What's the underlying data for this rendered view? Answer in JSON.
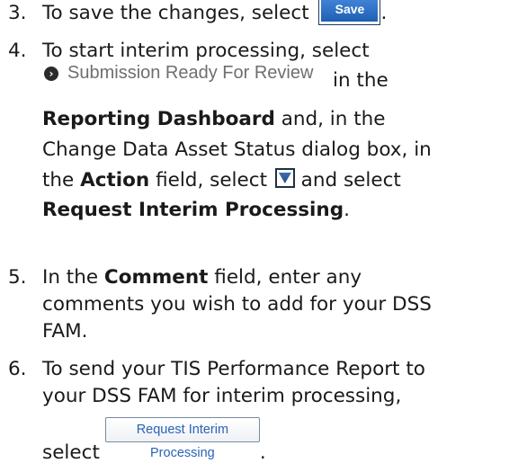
{
  "steps": [
    {
      "number": "3.",
      "text_before": "To save the changes, select",
      "button_label": "Save",
      "text_after": "."
    },
    {
      "number": "4.",
      "line1": "To start interim processing, select",
      "status_link_label": "Submission Ready For Review",
      "in_the": "in the",
      "reporting_dashboard": "Reporting Dashboard",
      "and_in_the": " and, in the",
      "line4": "Change Data Asset Status dialog box, in",
      "the": "the ",
      "action": "Action",
      "field_select": " field, select ",
      "and_select": " and select",
      "request_interim_processing": "Request Interim Processing",
      "period": "."
    },
    {
      "number": "5.",
      "in_the": "In the ",
      "comment": "Comment",
      "field_enter": " field, enter any",
      "line2": "comments you wish to add for your DSS",
      "line3": "FAM."
    },
    {
      "number": "6.",
      "line1": "To send your TIS Performance Report to",
      "line2": "your DSS FAM for interim processing,",
      "select": "select",
      "button_label": "Request Interim Processing",
      "period": "."
    }
  ],
  "icons": {
    "status_link_icon": "chevron-right-circle-icon",
    "dropdown_icon": "dropdown-arrow-icon"
  },
  "colors": {
    "save_button": "#2a6dc4",
    "link_text": "#6f6f6f",
    "request_button_text": "#2a62b8"
  }
}
